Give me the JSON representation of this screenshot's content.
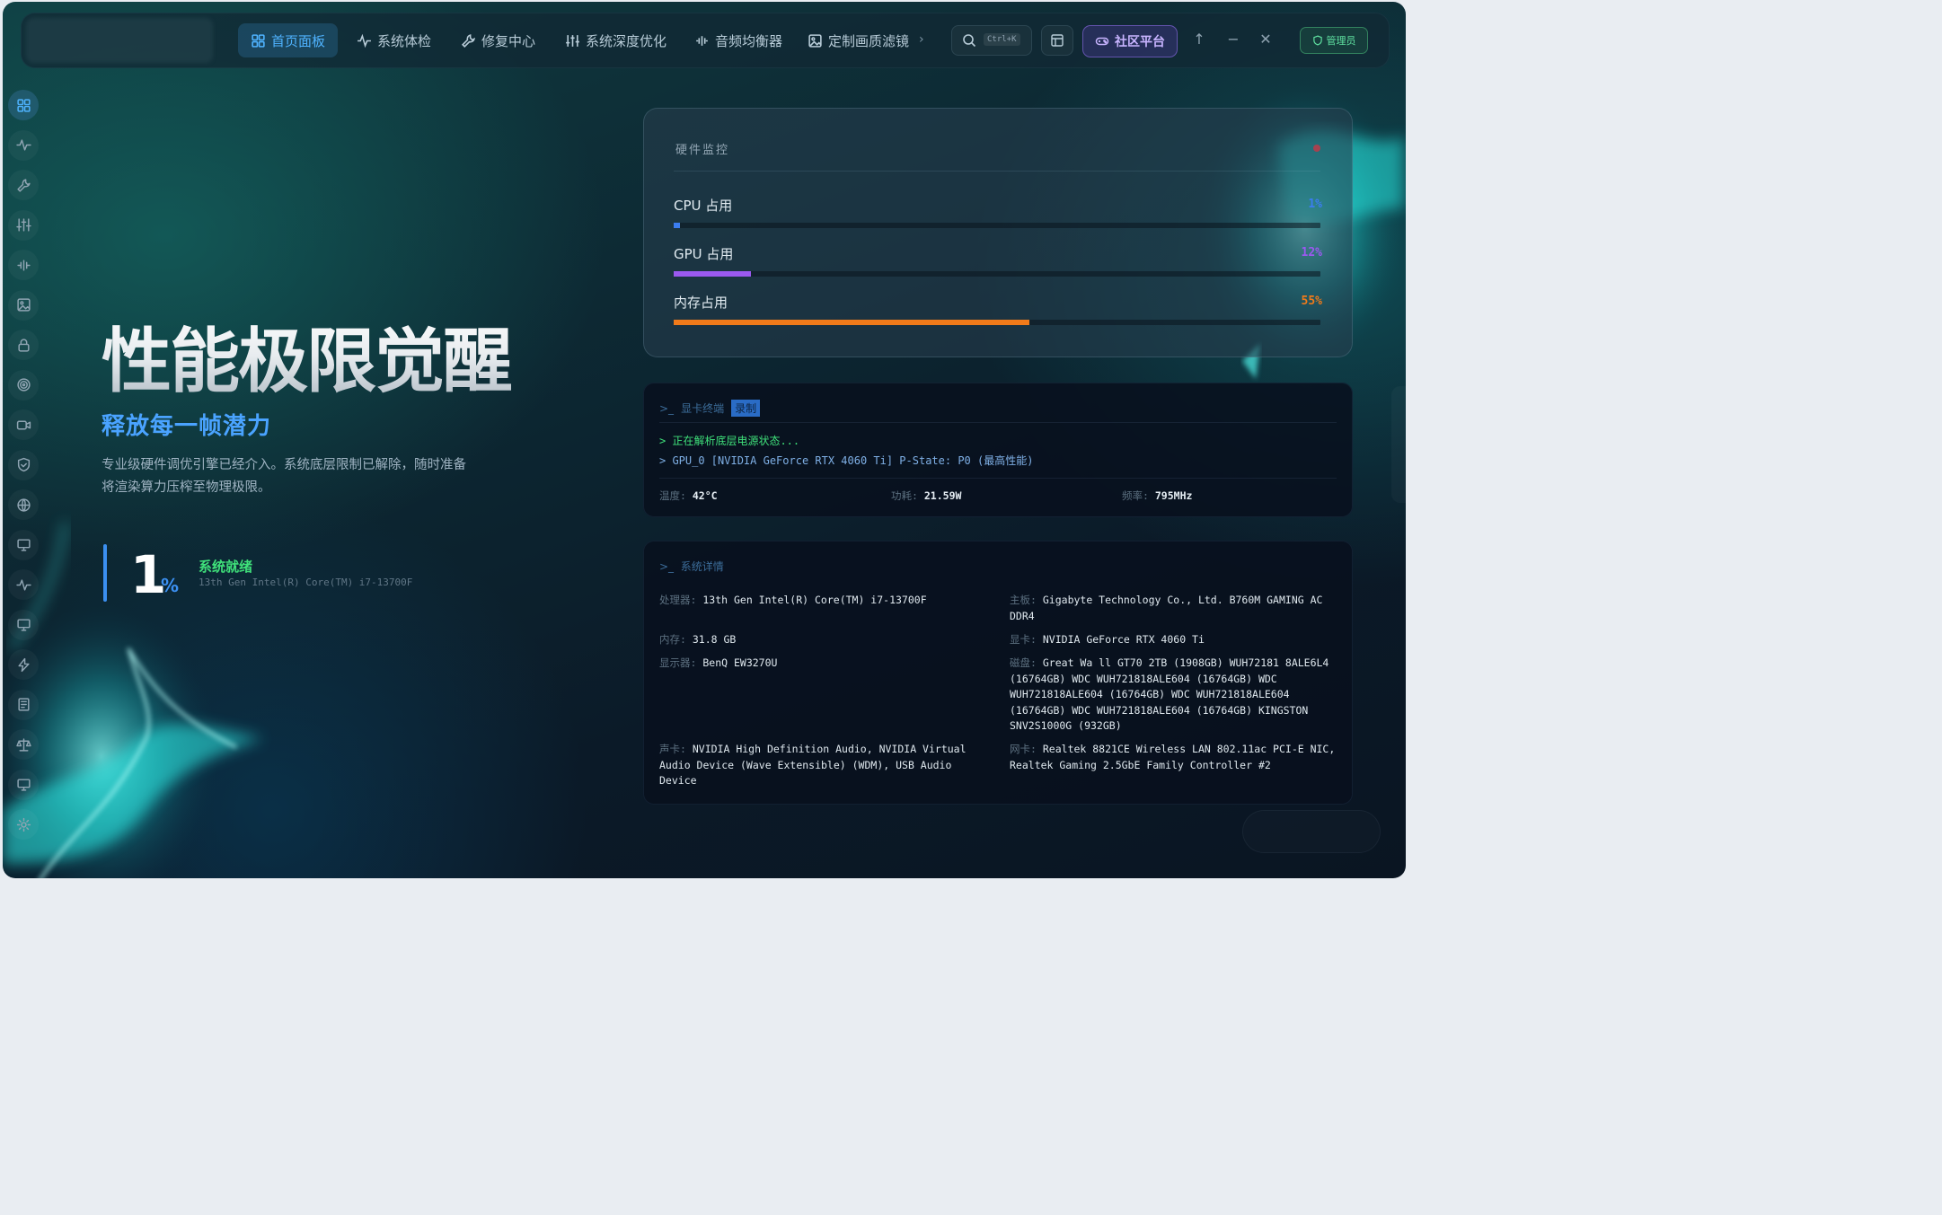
{
  "nav": {
    "items": [
      {
        "label": "首页面板",
        "icon": "grid-icon"
      },
      {
        "label": "系统体检",
        "icon": "pulse-icon"
      },
      {
        "label": "修复中心",
        "icon": "wrench-icon"
      },
      {
        "label": "系统深度优化",
        "icon": "sliders-icon"
      },
      {
        "label": "音频均衡器",
        "icon": "equalizer-icon"
      },
      {
        "label": "定制画质滤镜",
        "icon": "image-icon"
      }
    ],
    "search_shortcut": "Ctrl+K",
    "community_label": "社区平台",
    "admin_label": "管理员"
  },
  "sidebar": {
    "icons": [
      "grid-icon",
      "pulse-icon",
      "wrench-icon",
      "sliders-icon",
      "equalizer-icon",
      "image-icon",
      "lock-icon",
      "target-icon",
      "video-icon",
      "shield-icon",
      "globe-icon",
      "monitor-icon",
      "pulse-icon",
      "monitor-icon",
      "bolt-icon",
      "list-icon",
      "scale-icon",
      "monitor-icon",
      "gear-icon"
    ]
  },
  "hero": {
    "title": "性能极限觉醒",
    "subtitle": "释放每一帧潜力",
    "description": "专业级硬件调优引擎已经介入。系统底层限制已解除，随时准备将渲染算力压榨至物理极限。",
    "load_value": "1",
    "load_unit": "%",
    "status": "系统就绪",
    "cpu_name": "13th Gen Intel(R) Core(TM) i7-13700F"
  },
  "monitor": {
    "title": "硬件监控",
    "meters": [
      {
        "label": "CPU 占用",
        "value_text": "1%",
        "percent": 1,
        "color": "#3b7df0"
      },
      {
        "label": "GPU 占用",
        "value_text": "12%",
        "percent": 12,
        "color": "#9b59f0"
      },
      {
        "label": "内存占用",
        "value_text": "55%",
        "percent": 55,
        "color": "#f07a1a"
      }
    ]
  },
  "terminal": {
    "prompt": ">_",
    "title": "显卡终端",
    "badge": "录制",
    "line1": "> 正在解析底层电源状态...",
    "line2": "> GPU_0 [NVIDIA GeForce RTX 4060 Ti] P-State: P0 (最高性能)",
    "stats": [
      {
        "key": "温度:",
        "value": "42°C"
      },
      {
        "key": "功耗:",
        "value": "21.59W"
      },
      {
        "key": "频率:",
        "value": "795MHz"
      }
    ]
  },
  "system": {
    "prompt": ">_",
    "title": "系统详情",
    "items": [
      {
        "key": "处理器:",
        "value": "13th Gen Intel(R) Core(TM) i7-13700F"
      },
      {
        "key": "主板:",
        "value": "Gigabyte Technology Co., Ltd. B760M GAMING AC DDR4"
      },
      {
        "key": "内存:",
        "value": "31.8 GB"
      },
      {
        "key": "显卡:",
        "value": "NVIDIA GeForce RTX 4060 Ti"
      },
      {
        "key": "显示器:",
        "value": "BenQ EW3270U"
      },
      {
        "key": "磁盘:",
        "value": "Great Wa ll GT70 2TB (1908GB) WUH72181 8ALE6L4 (16764GB) WDC WUH721818ALE604 (16764GB) WDC WUH721818ALE604 (16764GB) WDC WUH721818ALE604 (16764GB) WDC WUH721818ALE604 (16764GB) KINGSTON SNV2S1000G (932GB)"
      },
      {
        "key": "声卡:",
        "value": "NVIDIA High Definition Audio, NVIDIA Virtual Audio Device (Wave Extensible) (WDM), USB Audio Device"
      },
      {
        "key": "网卡:",
        "value": "Realtek 8821CE Wireless LAN 802.11ac PCI-E NIC, Realtek Gaming 2.5GbE Family Controller #2"
      }
    ]
  }
}
